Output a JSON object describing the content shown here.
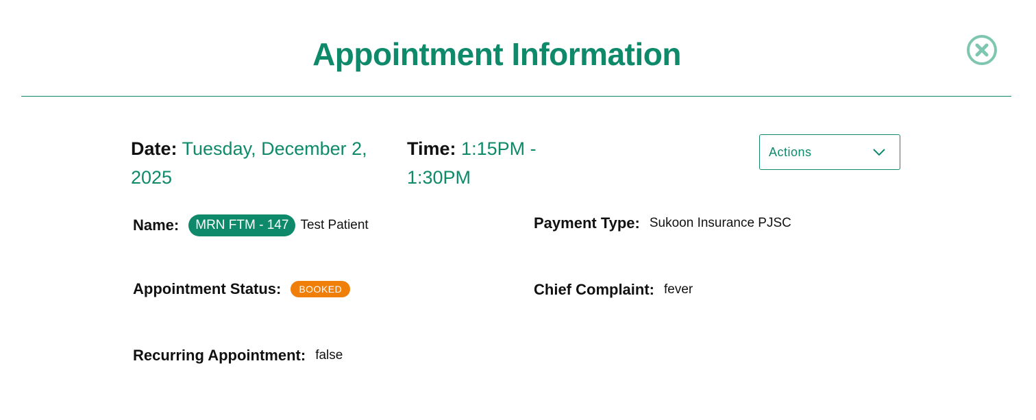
{
  "modal": {
    "title": "Appointment Information"
  },
  "appointment": {
    "date_label": "Date:",
    "date_value": "Tuesday, December 2, 2025",
    "time_label": "Time:",
    "time_value": "1:15PM - 1:30PM"
  },
  "actions": {
    "label": "Actions",
    "icon": "chevron-down-icon"
  },
  "fields": {
    "name_label": "Name:",
    "mrn": "MRN FTM - 147",
    "patient_name": "Test Patient",
    "payment_type_label": "Payment Type:",
    "payment_type_value": "Sukoon Insurance PJSC",
    "status_label": "Appointment Status:",
    "status_value": "BOOKED",
    "chief_complaint_label": "Chief Complaint:",
    "chief_complaint_value": "fever",
    "recurring_label": "Recurring Appointment:",
    "recurring_value": "false"
  },
  "colors": {
    "accent": "#0e8a6a",
    "close_icon": "#7fc6b1",
    "status_badge": "#f07f0a"
  }
}
